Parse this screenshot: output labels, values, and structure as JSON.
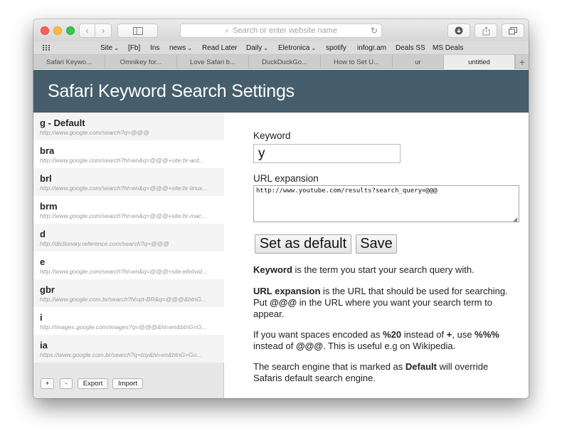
{
  "browser": {
    "address_placeholder": "Search or enter website name",
    "favorites": [
      {
        "label": "Site",
        "menu": true
      },
      {
        "label": "[Fb]",
        "menu": false
      },
      {
        "label": "Ins",
        "menu": false
      },
      {
        "label": "news",
        "menu": true
      },
      {
        "label": "Read Later",
        "menu": false
      },
      {
        "label": "Daily",
        "menu": true
      },
      {
        "label": "Eletronica",
        "menu": true
      },
      {
        "label": "spotify",
        "menu": false
      },
      {
        "label": "infogr.am",
        "menu": false
      },
      {
        "label": "Deals SS",
        "menu": false
      },
      {
        "label": "MS Deals",
        "menu": false
      }
    ],
    "tabs": [
      {
        "label": "Safari Keywo..."
      },
      {
        "label": "Omnikey for..."
      },
      {
        "label": "Love Safari b..."
      },
      {
        "label": "DuckDuckGo..."
      },
      {
        "label": "How to Set U..."
      },
      {
        "label": "ur"
      },
      {
        "label": "untitled"
      }
    ],
    "new_tab_label": "+"
  },
  "page": {
    "title": "Safari Keyword Search Settings",
    "keywords": [
      {
        "keyword": "g - Default",
        "url": "http://www.google.com/search?q=@@@"
      },
      {
        "keyword": "bra",
        "url": "http://www.google.com/search?hl=en&q=@@@+site:br-ard..."
      },
      {
        "keyword": "brl",
        "url": "http://www.google.com/search?hl=en&q=@@@+site:br-linux..."
      },
      {
        "keyword": "brm",
        "url": "http://www.google.com/search?hl=en&q=@@@+site:br-mac..."
      },
      {
        "keyword": "d",
        "url": "http://dictionary.reference.com/search?q=@@@"
      },
      {
        "keyword": "e",
        "url": "http://www.google.com/search?hl=en&q=@@@+site:efetivid..."
      },
      {
        "keyword": "gbr",
        "url": "http://www.google.com.br/search?hl=pt-BR&q=@@@&btnG..."
      },
      {
        "keyword": "i",
        "url": "http://images.google.com/images?q=@@@&hl=en&btnG=G..."
      },
      {
        "keyword": "ia",
        "url": "https://www.google.com.br/search?q=toy&hl=en&btnG=Go..."
      }
    ],
    "buttons": {
      "add": "+",
      "remove": "-",
      "export": "Export",
      "import": "Import"
    },
    "form": {
      "keyword_label": "Keyword",
      "keyword_value": "y",
      "url_label": "URL expansion",
      "url_value": "http://www.youtube.com/results?search_query=@@@",
      "set_default_label": "Set as default",
      "save_label": "Save"
    },
    "help": {
      "p1_bold": "Keyword",
      "p1_rest": " is the term you start your search query with.",
      "p2_bold1": "URL expansion",
      "p2_mid": " is the URL that should be used for searching. Put ",
      "p2_bold2": "@@@",
      "p2_rest": " in the URL where you want your search term to appear.",
      "p3_a": "If you want spaces encoded as ",
      "p3_b1": "%20",
      "p3_c": " instead of ",
      "p3_b2": "+",
      "p3_d": ", use ",
      "p3_b3": "%%%",
      "p3_e": " instead of ",
      "p3_b4": "@@@",
      "p3_f": ". This is useful e.g on Wikipedia.",
      "p4_a": "The search engine that is marked as ",
      "p4_b": "Default",
      "p4_c": " will override Safaris default search engine."
    }
  },
  "colors": {
    "banner": "#465d6b",
    "sidebar": "#e6e6e6"
  }
}
